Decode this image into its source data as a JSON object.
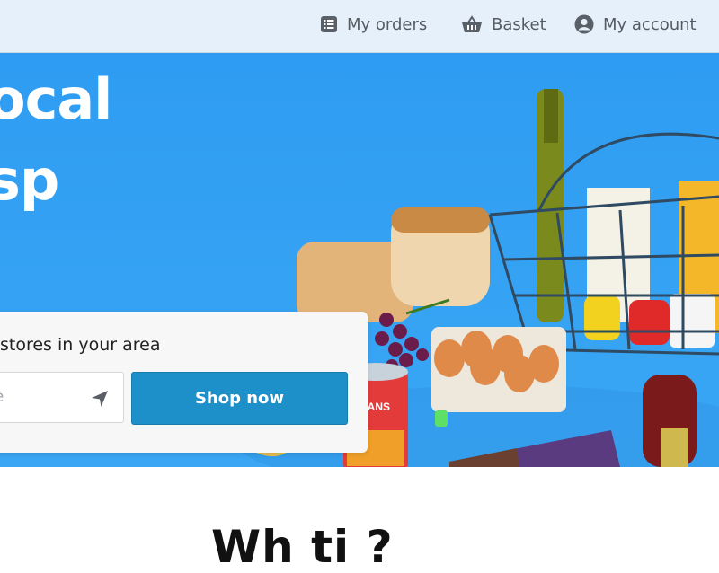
{
  "header": {
    "nav": [
      {
        "label": "My orders",
        "icon": "list-icon"
      },
      {
        "label": "Basket",
        "icon": "basket-icon"
      },
      {
        "label": "My account",
        "icon": "account-icon"
      }
    ]
  },
  "hero": {
    "headline_line1": "ocal",
    "headline_line2": "sp",
    "image": "groceries-illustration",
    "bean_can_label": "BEANS"
  },
  "search": {
    "title": "stores in your area",
    "postcode_placeholder": "de",
    "button_label": "Shop now"
  },
  "section": {
    "heading_partial": "Wh       ti  ?"
  },
  "colors": {
    "hero_blue": "#35a2f3",
    "button_blue": "#1d8fc9",
    "topbar": "#e6f0fa"
  }
}
